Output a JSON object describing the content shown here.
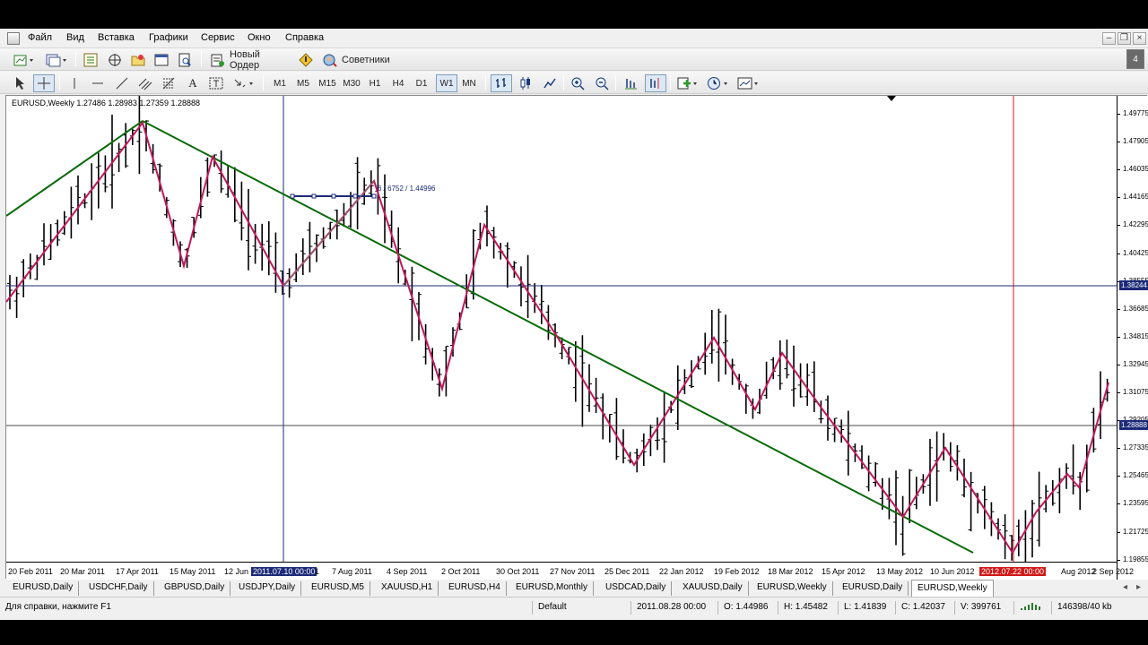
{
  "menu": [
    "Файл",
    "Вид",
    "Вставка",
    "Графики",
    "Сервис",
    "Окно",
    "Справка"
  ],
  "toolbar": {
    "new_order": "Новый Ордер",
    "experts": "Советники"
  },
  "timeframes": [
    "M1",
    "M5",
    "M15",
    "M30",
    "H1",
    "H4",
    "D1",
    "W1",
    "MN"
  ],
  "active_timeframe": "W1",
  "chart": {
    "header": "EURUSD,Weekly  1.27486 1.28983 1.27359 1.28888",
    "tool_label": "6 / 6752 / 1.44996",
    "price_ticks": [
      "1.49775",
      "1.47905",
      "1.46035",
      "1.44165",
      "1.42295",
      "1.40425",
      "1.38555",
      "1.36685",
      "1.34815",
      "1.32945",
      "1.31075",
      "1.29205",
      "1.27335",
      "1.25465",
      "1.23595",
      "1.21725",
      "1.19855"
    ],
    "crosshair_price": "1.38244",
    "last_price": "1.28888",
    "time_labels": [
      "20 Feb 2011",
      "20 Mar 2011",
      "17 Apr 2011",
      "15 May 2011",
      "12 Jun",
      "2011.07.10 00:00",
      "1",
      "7 Aug 2011",
      "4 Sep 2011",
      "2 Oct 2011",
      "30 Oct 2011",
      "27 Nov 2011",
      "25 Dec 2011",
      "22 Jan 2012",
      "19 Feb 2012",
      "18 Mar 2012",
      "15 Apr 2012",
      "13 May 2012",
      "10 Jun 2012",
      "2012.07.22 00:00",
      "Aug 2012",
      "2 Sep 2012"
    ],
    "colors": {
      "bars": "#000000",
      "zigzag": "#c2185b",
      "trendline": "#0b6b0b",
      "crosshair_blue": "#1c2a78",
      "crosshair_red": "#d01818"
    }
  },
  "tabs": [
    "EURUSD,Daily",
    "USDCHF,Daily",
    "GBPUSD,Daily",
    "USDJPY,Daily",
    "EURUSD,M5",
    "XAUUSD,H1",
    "EURUSD,H4",
    "EURUSD,Monthly",
    "USDCAD,Daily",
    "XAUUSD,Daily",
    "EURUSD,Weekly",
    "EURUSD,Daily",
    "EURUSD,Weekly"
  ],
  "active_tab": 12,
  "status": {
    "help": "Для справки, нажмите F1",
    "profile": "Default",
    "datetime": "2011.08.28 00:00",
    "open": "O: 1.44986",
    "high": "H: 1.45482",
    "low": "L: 1.41839",
    "close": "C: 1.42037",
    "volume": "V: 399761",
    "traffic": "146398/40 kb"
  }
}
